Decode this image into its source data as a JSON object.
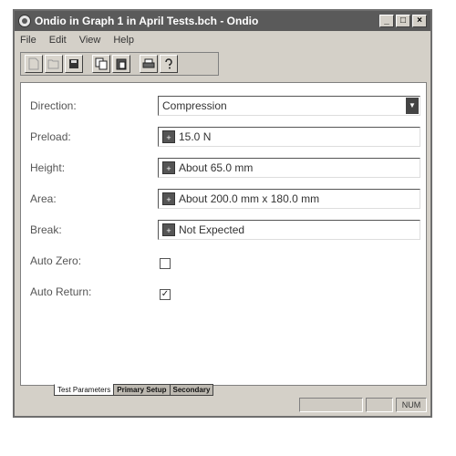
{
  "window": {
    "title": "Ondio in Graph 1 in April Tests.bch - Ondio",
    "minimize_glyph": "_",
    "maximize_glyph": "□",
    "close_glyph": "×"
  },
  "menu": {
    "items": [
      "File",
      "Edit",
      "View",
      "Help"
    ]
  },
  "toolbar": {
    "icons": [
      "new-icon",
      "open-icon",
      "save-icon",
      "copy-icon",
      "paste-icon",
      "print-icon",
      "help-icon"
    ]
  },
  "form": {
    "direction": {
      "label": "Direction:",
      "value": "Compression"
    },
    "preload": {
      "label": "Preload:",
      "value": "15.0 N"
    },
    "height": {
      "label": "Height:",
      "value": "About 65.0 mm"
    },
    "area": {
      "label": "Area:",
      "value": "About 200.0 mm x 180.0 mm"
    },
    "break": {
      "label": "Break:",
      "value": "Not Expected"
    },
    "auto_zero": {
      "label": "Auto Zero:",
      "checked": false,
      "mark": ""
    },
    "auto_return": {
      "label": "Auto Return:",
      "checked": true,
      "mark": "✓"
    }
  },
  "tabs": [
    "Test Parameters",
    "Primary Setup",
    "Secondary"
  ],
  "status": {
    "indicator": "NUM"
  }
}
